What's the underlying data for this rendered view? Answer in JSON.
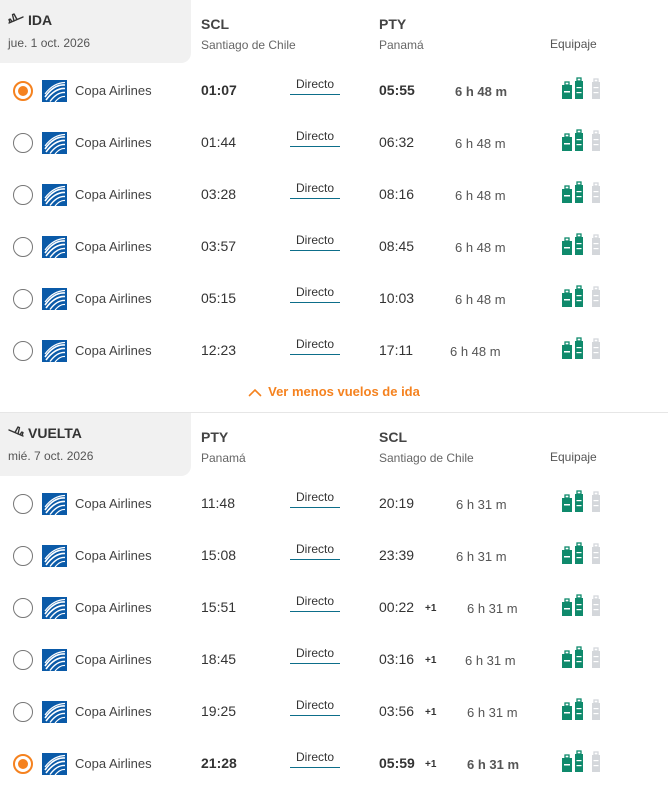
{
  "colors": {
    "accent": "#f5821f",
    "bag_green": "#0f8a6c",
    "bag_gray": "#d4d7db",
    "copa_blue": "#0a5aa8"
  },
  "outbound": {
    "direction_label": "IDA",
    "direction_icon": "plane-depart-icon",
    "date": "jue. 1 oct. 2026",
    "origin_code": "SCL",
    "origin_city": "Santiago de Chile",
    "dest_code": "PTY",
    "dest_city": "Panamá",
    "baggage_header": "Equipaje",
    "toggle_label": "Ver menos vuelos de ida",
    "flights": [
      {
        "airline": "Copa Airlines",
        "dep": "01:07",
        "stops": "Directo",
        "arr": "05:55",
        "plus": "",
        "duration": "6 h 48 m",
        "selected": true
      },
      {
        "airline": "Copa Airlines",
        "dep": "01:44",
        "stops": "Directo",
        "arr": "06:32",
        "plus": "",
        "duration": "6 h 48 m",
        "selected": false
      },
      {
        "airline": "Copa Airlines",
        "dep": "03:28",
        "stops": "Directo",
        "arr": "08:16",
        "plus": "",
        "duration": "6 h 48 m",
        "selected": false
      },
      {
        "airline": "Copa Airlines",
        "dep": "03:57",
        "stops": "Directo",
        "arr": "08:45",
        "plus": "",
        "duration": "6 h 48 m",
        "selected": false
      },
      {
        "airline": "Copa Airlines",
        "dep": "05:15",
        "stops": "Directo",
        "arr": "10:03",
        "plus": "",
        "duration": "6 h 48 m",
        "selected": false
      },
      {
        "airline": "Copa Airlines",
        "dep": "12:23",
        "stops": "Directo",
        "arr": "17:11",
        "plus": "",
        "duration": "6 h 48 m",
        "selected": false
      }
    ]
  },
  "inbound": {
    "direction_label": "VUELTA",
    "direction_icon": "plane-return-icon",
    "date": "mié. 7 oct. 2026",
    "origin_code": "PTY",
    "origin_city": "Panamá",
    "dest_code": "SCL",
    "dest_city": "Santiago de Chile",
    "baggage_header": "Equipaje",
    "flights": [
      {
        "airline": "Copa Airlines",
        "dep": "11:48",
        "stops": "Directo",
        "arr": "20:19",
        "plus": "",
        "duration": "6 h 31 m",
        "selected": false
      },
      {
        "airline": "Copa Airlines",
        "dep": "15:08",
        "stops": "Directo",
        "arr": "23:39",
        "plus": "",
        "duration": "6 h 31 m",
        "selected": false
      },
      {
        "airline": "Copa Airlines",
        "dep": "15:51",
        "stops": "Directo",
        "arr": "00:22",
        "plus": "+1",
        "duration": "6 h 31 m",
        "selected": false
      },
      {
        "airline": "Copa Airlines",
        "dep": "18:45",
        "stops": "Directo",
        "arr": "03:16",
        "plus": "+1",
        "duration": "6 h 31 m",
        "selected": false
      },
      {
        "airline": "Copa Airlines",
        "dep": "19:25",
        "stops": "Directo",
        "arr": "03:56",
        "plus": "+1",
        "duration": "6 h 31 m",
        "selected": false
      },
      {
        "airline": "Copa Airlines",
        "dep": "21:28",
        "stops": "Directo",
        "arr": "05:59",
        "plus": "+1",
        "duration": "6 h 31 m",
        "selected": true
      }
    ]
  }
}
